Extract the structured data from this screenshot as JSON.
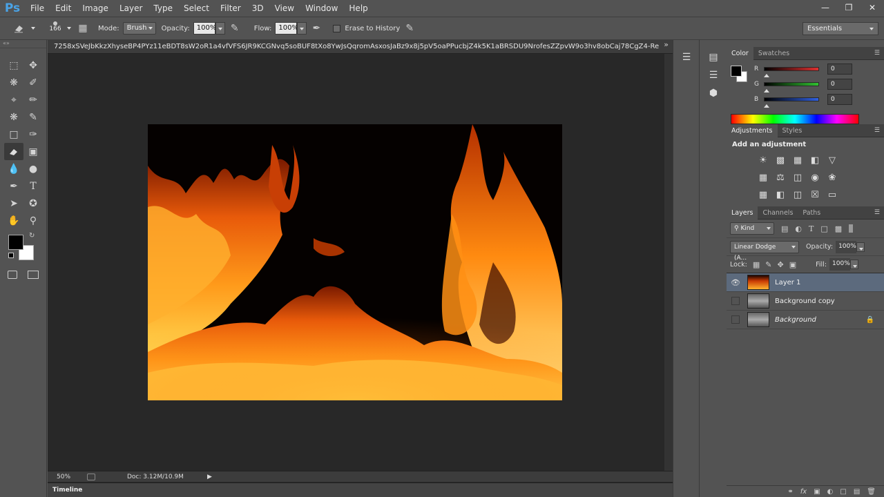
{
  "app": {
    "logo": "Ps",
    "menu": [
      "File",
      "Edit",
      "Image",
      "Layer",
      "Type",
      "Select",
      "Filter",
      "3D",
      "View",
      "Window",
      "Help"
    ],
    "window_controls": [
      "minimize",
      "restore",
      "close"
    ]
  },
  "options_bar": {
    "brush_size": "166",
    "mode_label": "Mode:",
    "mode_value": "Brush",
    "opacity_label": "Opacity:",
    "opacity_value": "100%",
    "flow_label": "Flow:",
    "flow_value": "100%",
    "erase_history_label": "Erase to History",
    "workspace": "Essentials"
  },
  "document": {
    "tab_title": "7258xSVeJbKkzXhyseBP4PYz11eBDT8sW2oR1a4vfVFS6JR9KCGNvq5soBUF8tXo8YwJsQqromAsxosJaBz9x8j5pV5oaPPucbjZ4k5K1aBRSDU9NrofesZZpvW9o3hv8obCaj78CgZ4-Re",
    "zoom": "50%",
    "doc_size": "Doc: 3.12M/10.9M",
    "timeline_label": "Timeline"
  },
  "color_panel": {
    "tabs": [
      "Color",
      "Swatches"
    ],
    "channels": [
      {
        "label": "R",
        "value": "0",
        "color": "#e03030"
      },
      {
        "label": "G",
        "value": "0",
        "color": "#30c030"
      },
      {
        "label": "B",
        "value": "0",
        "color": "#3060e0"
      }
    ]
  },
  "adjustments_panel": {
    "tabs": [
      "Adjustments",
      "Styles"
    ],
    "heading": "Add an adjustment"
  },
  "layers_panel": {
    "tabs": [
      "Layers",
      "Channels",
      "Paths"
    ],
    "filter_kind": "Kind",
    "blend_mode": "Linear Dodge (A...",
    "opacity_label": "Opacity:",
    "opacity_value": "100%",
    "lock_label": "Lock:",
    "fill_label": "Fill:",
    "fill_value": "100%",
    "layers": [
      {
        "name": "Layer 1",
        "visible": true,
        "selected": true
      },
      {
        "name": "Background copy",
        "visible": false,
        "selected": false
      },
      {
        "name": "Background",
        "visible": false,
        "selected": false,
        "locked": true
      }
    ]
  }
}
